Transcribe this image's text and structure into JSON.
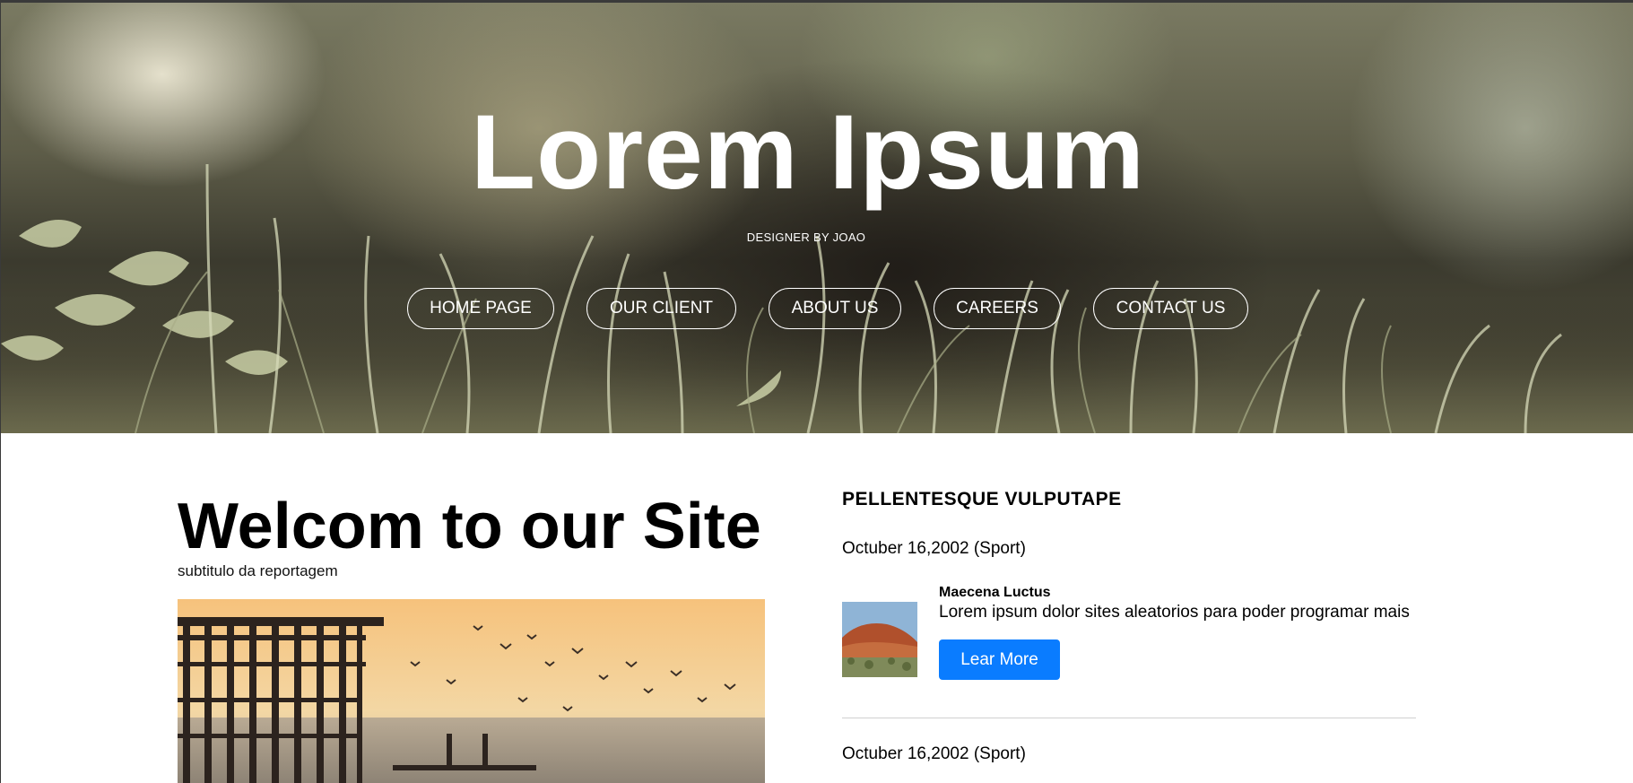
{
  "hero": {
    "title": "Lorem Ipsum",
    "subtitle": "DESIGNER BY JOAO"
  },
  "nav": {
    "items": [
      {
        "label": "HOME PAGE"
      },
      {
        "label": "OUR CLIENT"
      },
      {
        "label": "ABOUT US"
      },
      {
        "label": "CAREERS"
      },
      {
        "label": "CONTACT US"
      }
    ]
  },
  "main": {
    "title": "Welcom to our Site",
    "subtitle": "subtitulo da reportagem"
  },
  "sidebar": {
    "heading": "PELLENTESQUE VULPUTAPE",
    "posts": [
      {
        "date": "Octuber 16,2002 (Sport)",
        "title": "Maecena Luctus",
        "text": "Lorem ipsum dolor sites aleatorios para poder programar mais",
        "button_label": "Lear More"
      },
      {
        "date": "Octuber 16,2002 (Sport)"
      }
    ]
  },
  "colors": {
    "accent": "#0a7cff",
    "text": "#000000",
    "background": "#ffffff"
  }
}
